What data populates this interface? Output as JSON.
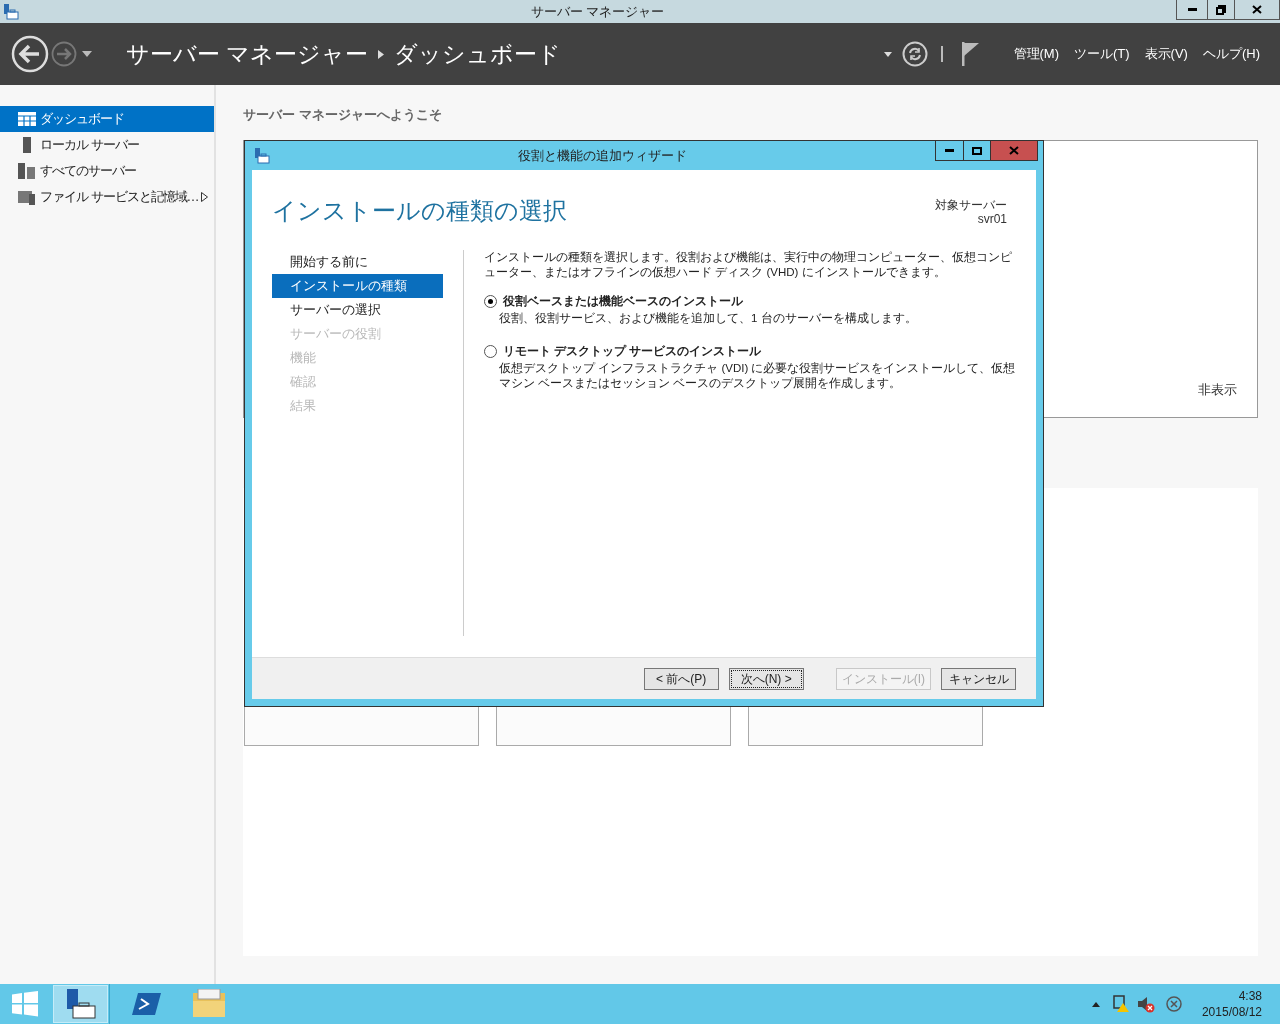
{
  "window": {
    "title": "サーバー マネージャー"
  },
  "header": {
    "breadcrumb": [
      "サーバー マネージャー",
      "ダッシュボード"
    ],
    "menus": [
      "管理(M)",
      "ツール(T)",
      "表示(V)",
      "ヘルプ(H)"
    ]
  },
  "sidebar": {
    "items": [
      {
        "label": "ダッシュボード",
        "selected": true,
        "expandable": false
      },
      {
        "label": "ローカル サーバー",
        "selected": false,
        "expandable": false
      },
      {
        "label": "すべてのサーバー",
        "selected": false,
        "expandable": false
      },
      {
        "label": "ファイル サービスと記憶域…",
        "selected": false,
        "expandable": true
      }
    ]
  },
  "welcome": {
    "title": "サーバー マネージャーへようこそ",
    "hide_link": "非表示"
  },
  "dialog": {
    "title": "役割と機能の追加ウィザード",
    "heading": "インストールの種類の選択",
    "target_label": "対象サーバー",
    "target_server": "svr01",
    "steps": [
      {
        "label": "開始する前に",
        "selected": false,
        "disabled": false
      },
      {
        "label": "インストールの種類",
        "selected": true,
        "disabled": false
      },
      {
        "label": "サーバーの選択",
        "selected": false,
        "disabled": false
      },
      {
        "label": "サーバーの役割",
        "selected": false,
        "disabled": true
      },
      {
        "label": "機能",
        "selected": false,
        "disabled": true
      },
      {
        "label": "確認",
        "selected": false,
        "disabled": true
      },
      {
        "label": "結果",
        "selected": false,
        "disabled": true
      }
    ],
    "description": "インストールの種類を選択します。役割および機能は、実行中の物理コンピューター、仮想コンピューター、またはオフラインの仮想ハード ディスク (VHD) にインストールできます。",
    "options": [
      {
        "label": "役割ベースまたは機能ベースのインストール",
        "description": "役割、役割サービス、および機能を追加して、1 台のサーバーを構成します。",
        "selected": true
      },
      {
        "label": "リモート デスクトップ サービスのインストール",
        "description": "仮想デスクトップ インフラストラクチャ (VDI) に必要な役割サービスをインストールして、仮想マシン ベースまたはセッション ベースのデスクトップ展開を作成します。",
        "selected": false
      }
    ],
    "buttons": [
      {
        "label": "< 前へ(P)",
        "disabled": false,
        "focused": false
      },
      {
        "label": "次へ(N) >",
        "disabled": false,
        "focused": true
      },
      {
        "label": "インストール(I)",
        "disabled": true,
        "focused": false
      },
      {
        "label": "キャンセル",
        "disabled": false,
        "focused": false
      }
    ]
  },
  "taskbar": {
    "time": "4:38",
    "date": "2015/08/12"
  }
}
